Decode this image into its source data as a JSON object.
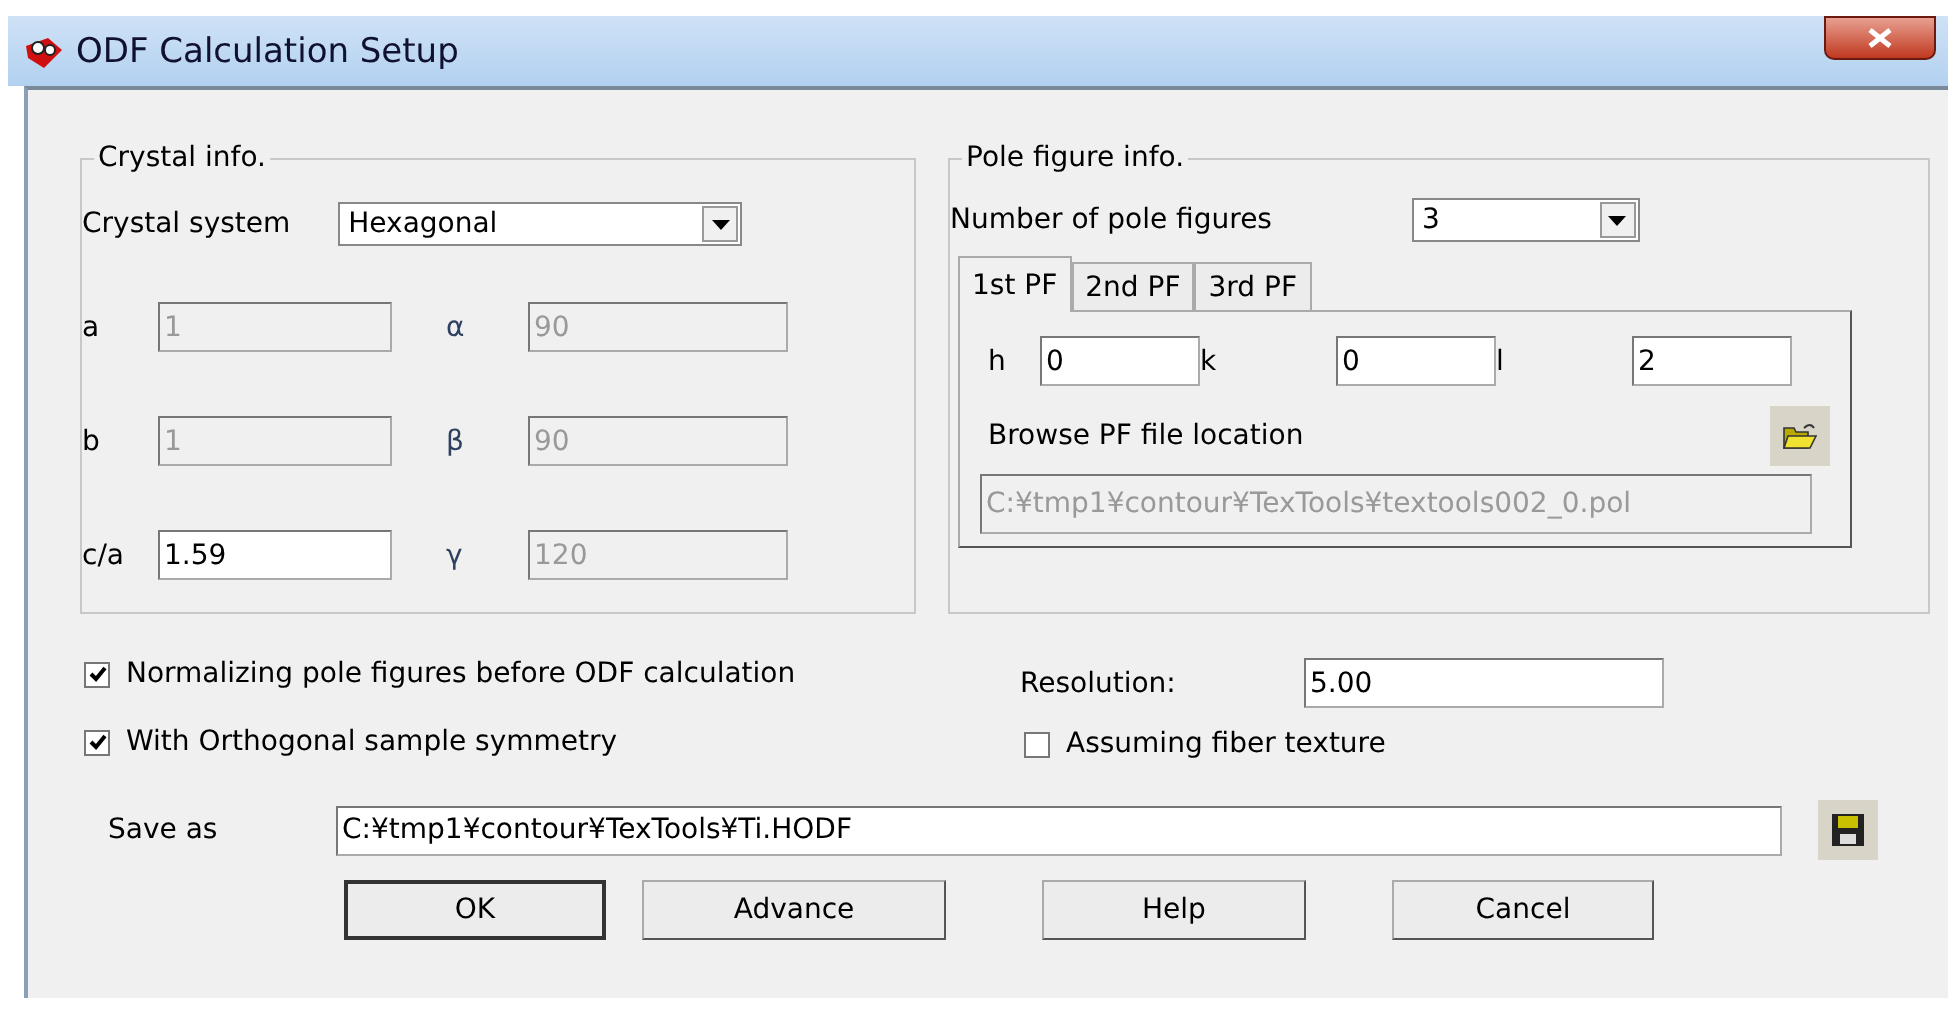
{
  "window": {
    "title": "ODF Calculation Setup"
  },
  "crystal_info": {
    "title": "Crystal info.",
    "crystal_system_label": "Crystal system",
    "crystal_system": "Hexagonal",
    "params": [
      {
        "label": "a",
        "value": "1",
        "disabled": true
      },
      {
        "label": "α",
        "value": "90",
        "disabled": true
      },
      {
        "label": "b",
        "value": "1",
        "disabled": true
      },
      {
        "label": "β",
        "value": "90",
        "disabled": true
      },
      {
        "label": "c/a",
        "value": "1.59",
        "disabled": false
      },
      {
        "label": "γ",
        "value": "120",
        "disabled": true
      }
    ]
  },
  "pole_figure_info": {
    "title": "Pole figure info.",
    "count_label": "Number of pole figures",
    "count": "3",
    "tabs": [
      {
        "label": "1st PF",
        "selected": true
      },
      {
        "label": "2nd PF",
        "selected": false
      },
      {
        "label": "3rd PF",
        "selected": false
      }
    ],
    "indices": [
      {
        "label": "h",
        "value": "0"
      },
      {
        "label": "k",
        "value": "0"
      },
      {
        "label": "l",
        "value": "2"
      }
    ],
    "browse_label": "Browse PF file location",
    "file_path": "C:¥tmp1¥contour¥TexTools¥textools002_0.pol"
  },
  "options": [
    {
      "label": "Normalizing pole figures before ODF calculation",
      "checked": true
    },
    {
      "label": "With Orthogonal sample symmetry",
      "checked": true
    }
  ],
  "resolution": {
    "label": "Resolution:",
    "value": "5.00"
  },
  "fiber_texture": {
    "label": "Assuming fiber texture",
    "checked": false
  },
  "save_as": {
    "label": "Save as",
    "value": "C:¥tmp1¥contour¥TexTools¥Ti.HODF"
  },
  "buttons": [
    {
      "label": "OK",
      "default": true
    },
    {
      "label": "Advance",
      "default": false
    },
    {
      "label": "Help",
      "default": false
    },
    {
      "label": "Cancel",
      "default": false
    }
  ]
}
